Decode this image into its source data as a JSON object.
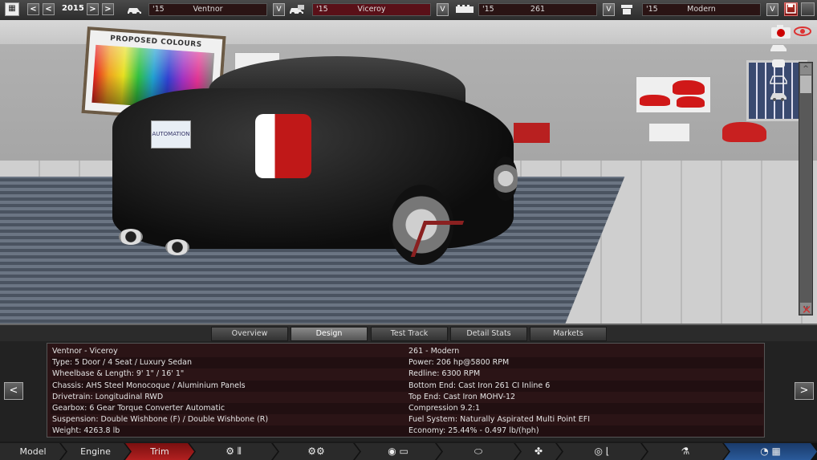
{
  "topbar": {
    "year": "2015",
    "model": {
      "year": "'15",
      "name": "Ventnor"
    },
    "trim": {
      "year": "'15",
      "name": "Viceroy"
    },
    "engine": {
      "year": "'15",
      "name": "261"
    },
    "variant": {
      "year": "'15",
      "name": "Modern"
    },
    "prev_label": "<",
    "prev2_label": "<",
    "next_label": ">",
    "next2_label": ">",
    "dropdown_label": "V",
    "icons": [
      "calendar-icon",
      "car-icon",
      "car-badge-icon",
      "engine-icon",
      "variant-icon",
      "save-icon"
    ]
  },
  "viewport": {
    "poster_title": "PROPOSED COLOURS",
    "plate_text": "AUTOMATION",
    "right_tools": [
      "camera-icon",
      "car-view-icon",
      "car-top-icon",
      "car-side-icon",
      "car-paint-icon",
      "eye-icon"
    ],
    "scroll_up": "^",
    "scroll_down": "v"
  },
  "tabs": [
    {
      "label": "Overview",
      "active": false
    },
    {
      "label": "Design",
      "active": true
    },
    {
      "label": "Test Track",
      "active": false
    },
    {
      "label": "Detail Stats",
      "active": false
    },
    {
      "label": "Markets",
      "active": false
    }
  ],
  "stats": {
    "left": [
      "Ventnor - Viceroy",
      "Type: 5 Door / 4 Seat / Luxury Sedan",
      "Wheelbase & Length: 9' 1\" / 16' 1\"",
      "Chassis: AHS Steel Monocoque / Aluminium Panels",
      "Drivetrain: Longitudinal RWD",
      "Gearbox: 6 Gear Torque Converter Automatic",
      "Suspension: Double Wishbone (F) / Double Wishbone (R)",
      "Weight: 4263.8 lb"
    ],
    "right": [
      "261 - Modern",
      "Power: 206 hp@5800 RPM",
      "Redline: 6300 RPM",
      "Bottom End: Cast Iron 261 CI Inline 6",
      "Top End: Cast Iron MOHV-12",
      "Compression 9.2:1",
      "Fuel System: Naturally Aspirated Multi Point EFI",
      "Economy: 25.44% - 0.497 lb/(hph)"
    ],
    "prev_label": "<",
    "next_label": ">"
  },
  "bottom_nav": {
    "model": "Model",
    "engine": "Engine",
    "trim": "Trim",
    "icons": [
      "drivetrain-gearbox-icon",
      "suspension-icon",
      "wheels-body-icon",
      "fan-icon",
      "car-body-icon",
      "steering-seat-icon",
      "fuel-icon",
      "test-track-icon"
    ]
  }
}
